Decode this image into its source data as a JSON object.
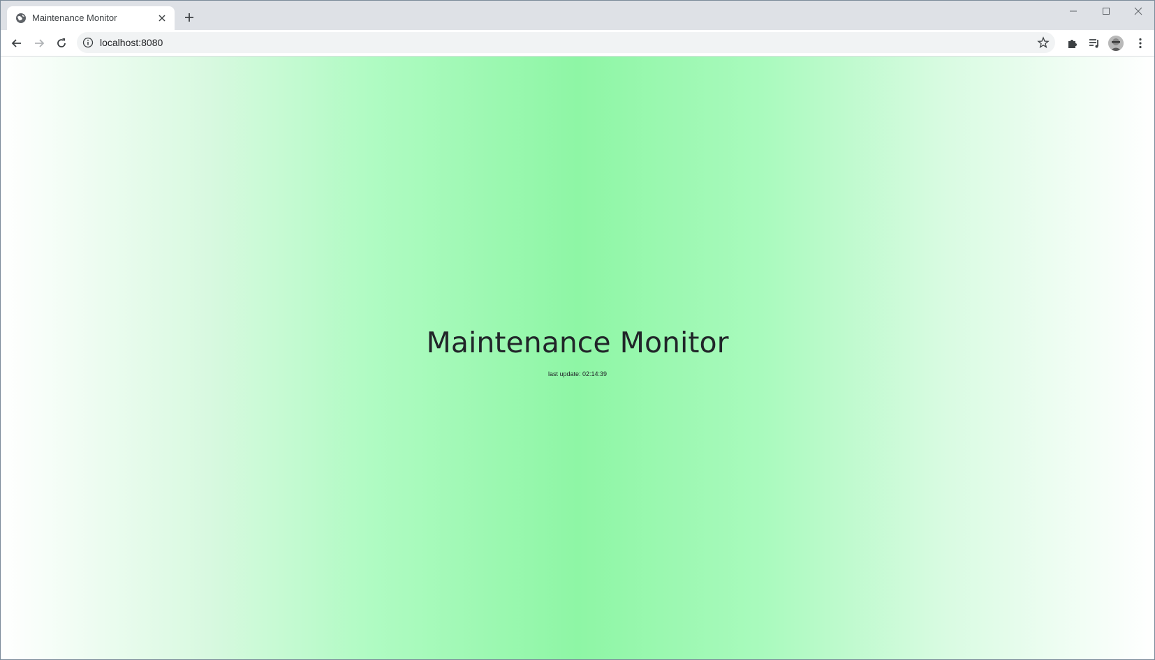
{
  "browser": {
    "tab": {
      "title": "Maintenance Monitor",
      "favicon": "globe-icon"
    },
    "new_tab_icon": "plus-icon",
    "window_controls": [
      "minimize-icon",
      "maximize-icon",
      "close-icon"
    ],
    "toolbar": {
      "back_icon": "arrow-left-icon",
      "forward_icon": "arrow-right-icon",
      "reload_icon": "reload-icon",
      "url": "localhost:8080",
      "site_info_icon": "info-icon",
      "bookmark_icon": "star-icon",
      "extensions_icon": "puzzle-icon",
      "media_icon": "playlist-icon",
      "profile_icon": "avatar",
      "menu_icon": "kebab-menu-icon"
    }
  },
  "page": {
    "title": "Maintenance Monitor",
    "last_update": "last update: 02:14:39",
    "colors": {
      "background_center": "#8ef6a5",
      "background_edge": "#ffffff",
      "text": "#212529"
    }
  }
}
